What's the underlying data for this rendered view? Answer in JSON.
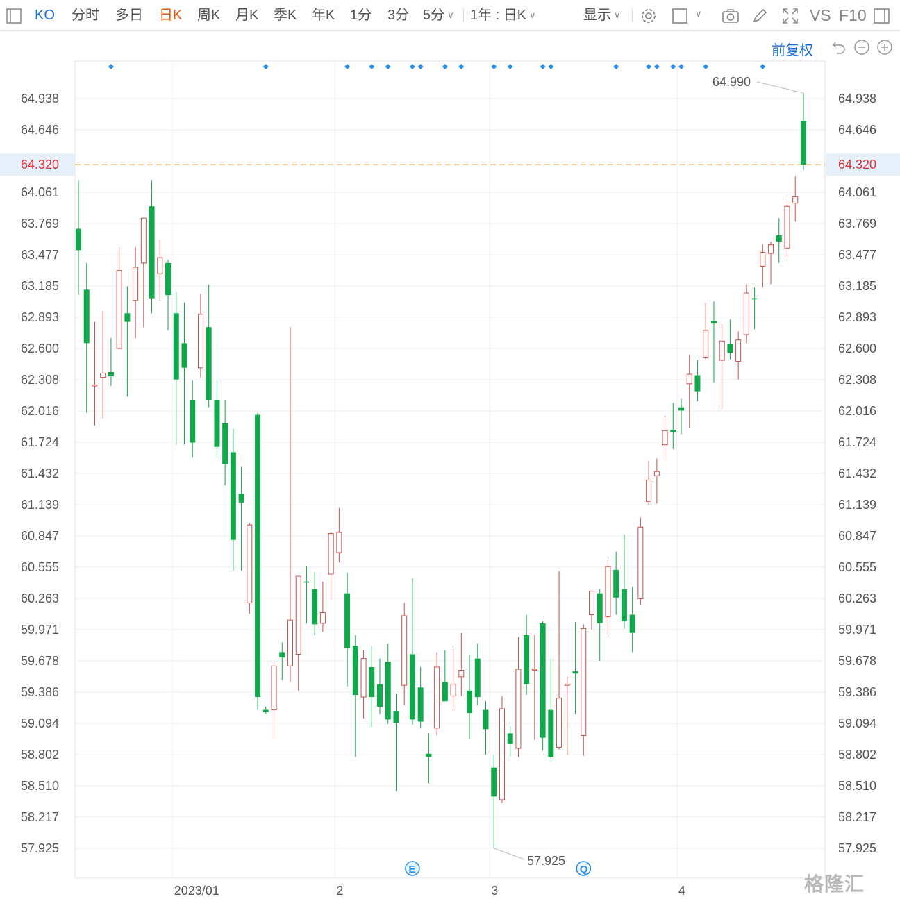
{
  "toolbar": {
    "symbol": "KO",
    "periods": [
      "分时",
      "多日",
      "日K",
      "周K",
      "月K",
      "季K",
      "年K",
      "1分",
      "3分",
      "5分"
    ],
    "active_period": "日K",
    "range_label": "1年 : 日K",
    "display_label": "显示",
    "vs_label": "VS",
    "f10_label": "F10"
  },
  "subbar": {
    "adjust_label": "前复权"
  },
  "icons": [
    "sidebar-toggle-icon",
    "settings-icon",
    "layout-square-icon",
    "camera-icon",
    "pencil-icon",
    "fullscreen-icon",
    "panel-icon",
    "undo-icon",
    "zoom-out-icon",
    "zoom-in-icon"
  ],
  "colors": {
    "up": "#c8504a",
    "down": "#10a84b",
    "marker": "#2d8ee6",
    "last_line": "#e09a30",
    "last_text": "#e03333",
    "active_tab": "#e8590c",
    "link": "#1e6fd0"
  },
  "watermark": "格隆汇",
  "chart_data": {
    "type": "candlestick",
    "title": "",
    "ylabel": "",
    "ylim": [
      57.8,
      65.15
    ],
    "y_ticks": [
      "64.938",
      "64.646",
      "64.320",
      "64.061",
      "63.769",
      "63.477",
      "63.185",
      "62.893",
      "62.600",
      "62.308",
      "62.016",
      "61.724",
      "61.432",
      "61.139",
      "60.847",
      "60.555",
      "60.263",
      "59.971",
      "59.678",
      "59.386",
      "59.094",
      "58.802",
      "58.510",
      "58.217",
      "57.925"
    ],
    "x_ticks": [
      {
        "label": "2023/01",
        "index": 12
      },
      {
        "label": "2",
        "index": 32
      },
      {
        "label": "3",
        "index": 51
      },
      {
        "label": "4",
        "index": 74
      }
    ],
    "last_price": "64.320",
    "high_label": "64.990",
    "low_label": "57.925",
    "grid": true,
    "event_badges": [
      {
        "label": "E",
        "index": 41
      },
      {
        "label": "Q",
        "index": 62
      }
    ],
    "markers": [
      4,
      23,
      33,
      36,
      38,
      41,
      42,
      45,
      47,
      51,
      53,
      57,
      58,
      66,
      70,
      71,
      73,
      74,
      77,
      84
    ],
    "candles": [
      {
        "o": 63.72,
        "h": 64.17,
        "l": 63.1,
        "c": 63.52
      },
      {
        "o": 63.15,
        "h": 63.4,
        "l": 62.0,
        "c": 62.65
      },
      {
        "o": 62.25,
        "h": 62.85,
        "l": 61.88,
        "c": 62.26
      },
      {
        "o": 62.33,
        "h": 62.95,
        "l": 61.95,
        "c": 62.37
      },
      {
        "o": 62.38,
        "h": 62.7,
        "l": 62.25,
        "c": 62.34
      },
      {
        "o": 62.6,
        "h": 63.55,
        "l": 62.6,
        "c": 63.33
      },
      {
        "o": 62.93,
        "h": 63.18,
        "l": 62.15,
        "c": 62.85
      },
      {
        "o": 63.05,
        "h": 63.55,
        "l": 62.7,
        "c": 63.36
      },
      {
        "o": 63.4,
        "h": 63.82,
        "l": 62.8,
        "c": 63.82
      },
      {
        "o": 63.93,
        "h": 64.17,
        "l": 62.93,
        "c": 63.07
      },
      {
        "o": 63.3,
        "h": 63.62,
        "l": 63.05,
        "c": 63.45
      },
      {
        "o": 63.4,
        "h": 63.43,
        "l": 62.77,
        "c": 63.1
      },
      {
        "o": 62.93,
        "h": 63.13,
        "l": 61.7,
        "c": 62.31
      },
      {
        "o": 62.65,
        "h": 63.03,
        "l": 61.7,
        "c": 62.42
      },
      {
        "o": 62.12,
        "h": 62.3,
        "l": 61.58,
        "c": 61.72
      },
      {
        "o": 62.42,
        "h": 63.11,
        "l": 62.33,
        "c": 62.92
      },
      {
        "o": 62.8,
        "h": 63.2,
        "l": 62.05,
        "c": 62.12
      },
      {
        "o": 62.12,
        "h": 62.3,
        "l": 61.58,
        "c": 61.68
      },
      {
        "o": 61.9,
        "h": 62.12,
        "l": 61.32,
        "c": 61.52
      },
      {
        "o": 61.63,
        "h": 61.85,
        "l": 60.52,
        "c": 60.81
      },
      {
        "o": 61.24,
        "h": 61.5,
        "l": 60.52,
        "c": 61.16
      },
      {
        "o": 60.22,
        "h": 60.97,
        "l": 60.12,
        "c": 60.95
      },
      {
        "o": 61.98,
        "h": 62.0,
        "l": 59.22,
        "c": 59.34
      },
      {
        "o": 59.22,
        "h": 59.25,
        "l": 59.18,
        "c": 59.2
      },
      {
        "o": 59.22,
        "h": 59.66,
        "l": 58.95,
        "c": 59.63
      },
      {
        "o": 59.76,
        "h": 59.85,
        "l": 59.5,
        "c": 59.71
      },
      {
        "o": 59.63,
        "h": 62.8,
        "l": 59.48,
        "c": 60.06
      },
      {
        "o": 59.74,
        "h": 60.47,
        "l": 59.4,
        "c": 60.47
      },
      {
        "o": 60.42,
        "h": 60.56,
        "l": 60.03,
        "c": 60.41
      },
      {
        "o": 60.35,
        "h": 60.51,
        "l": 59.92,
        "c": 60.02
      },
      {
        "o": 60.03,
        "h": 60.42,
        "l": 59.95,
        "c": 60.13
      },
      {
        "o": 60.49,
        "h": 60.88,
        "l": 60.25,
        "c": 60.87
      },
      {
        "o": 60.69,
        "h": 61.11,
        "l": 60.6,
        "c": 60.88
      },
      {
        "o": 60.31,
        "h": 60.5,
        "l": 59.44,
        "c": 59.8
      },
      {
        "o": 59.82,
        "h": 59.92,
        "l": 58.78,
        "c": 59.36
      },
      {
        "o": 59.34,
        "h": 59.78,
        "l": 59.14,
        "c": 59.7
      },
      {
        "o": 59.62,
        "h": 59.82,
        "l": 59.06,
        "c": 59.34
      },
      {
        "o": 59.46,
        "h": 59.7,
        "l": 59.18,
        "c": 59.25
      },
      {
        "o": 59.67,
        "h": 59.84,
        "l": 59.09,
        "c": 59.13
      },
      {
        "o": 59.21,
        "h": 59.37,
        "l": 58.46,
        "c": 59.1
      },
      {
        "o": 59.45,
        "h": 60.22,
        "l": 59.26,
        "c": 60.1
      },
      {
        "o": 59.74,
        "h": 60.45,
        "l": 59.08,
        "c": 59.13
      },
      {
        "o": 59.43,
        "h": 59.62,
        "l": 59.05,
        "c": 59.11
      },
      {
        "o": 58.81,
        "h": 59.0,
        "l": 58.53,
        "c": 58.78
      },
      {
        "o": 59.05,
        "h": 59.76,
        "l": 58.98,
        "c": 59.62
      },
      {
        "o": 59.48,
        "h": 59.78,
        "l": 59.31,
        "c": 59.3
      },
      {
        "o": 59.35,
        "h": 59.79,
        "l": 59.22,
        "c": 59.46
      },
      {
        "o": 59.53,
        "h": 59.94,
        "l": 59.35,
        "c": 59.59
      },
      {
        "o": 59.4,
        "h": 59.73,
        "l": 58.95,
        "c": 59.19
      },
      {
        "o": 59.7,
        "h": 59.84,
        "l": 59.26,
        "c": 59.34
      },
      {
        "o": 59.22,
        "h": 59.3,
        "l": 58.8,
        "c": 59.04
      },
      {
        "o": 58.68,
        "h": 58.8,
        "l": 57.925,
        "c": 58.41
      },
      {
        "o": 58.38,
        "h": 59.35,
        "l": 58.35,
        "c": 59.23
      },
      {
        "o": 59.0,
        "h": 59.07,
        "l": 58.78,
        "c": 58.9
      },
      {
        "o": 58.86,
        "h": 59.9,
        "l": 58.78,
        "c": 59.6
      },
      {
        "o": 59.92,
        "h": 60.11,
        "l": 59.36,
        "c": 59.46
      },
      {
        "o": 59.59,
        "h": 59.92,
        "l": 58.94,
        "c": 59.6
      },
      {
        "o": 60.03,
        "h": 60.05,
        "l": 58.84,
        "c": 58.96
      },
      {
        "o": 59.22,
        "h": 59.7,
        "l": 58.74,
        "c": 58.78
      },
      {
        "o": 58.87,
        "h": 60.52,
        "l": 58.85,
        "c": 59.33
      },
      {
        "o": 59.46,
        "h": 59.53,
        "l": 58.8,
        "c": 59.46
      },
      {
        "o": 59.58,
        "h": 60.04,
        "l": 59.18,
        "c": 59.56
      },
      {
        "o": 58.98,
        "h": 60.02,
        "l": 58.79,
        "c": 59.98
      },
      {
        "o": 60.11,
        "h": 60.33,
        "l": 59.97,
        "c": 60.33
      },
      {
        "o": 60.31,
        "h": 60.35,
        "l": 59.68,
        "c": 60.03
      },
      {
        "o": 60.09,
        "h": 60.62,
        "l": 59.93,
        "c": 60.56
      },
      {
        "o": 60.53,
        "h": 60.7,
        "l": 60.11,
        "c": 60.27
      },
      {
        "o": 60.35,
        "h": 60.86,
        "l": 59.98,
        "c": 60.05
      },
      {
        "o": 60.11,
        "h": 60.37,
        "l": 59.76,
        "c": 59.94
      },
      {
        "o": 60.26,
        "h": 61.02,
        "l": 60.2,
        "c": 60.93
      },
      {
        "o": 61.17,
        "h": 61.55,
        "l": 61.14,
        "c": 61.37
      },
      {
        "o": 61.41,
        "h": 61.57,
        "l": 61.15,
        "c": 61.45
      },
      {
        "o": 61.7,
        "h": 61.97,
        "l": 61.55,
        "c": 61.83
      },
      {
        "o": 61.84,
        "h": 62.09,
        "l": 61.66,
        "c": 61.82
      },
      {
        "o": 62.05,
        "h": 62.13,
        "l": 61.8,
        "c": 62.02
      },
      {
        "o": 62.27,
        "h": 62.54,
        "l": 61.86,
        "c": 62.36
      },
      {
        "o": 62.35,
        "h": 62.49,
        "l": 62.11,
        "c": 62.2
      },
      {
        "o": 62.52,
        "h": 63.03,
        "l": 62.49,
        "c": 62.77
      },
      {
        "o": 62.86,
        "h": 63.04,
        "l": 62.28,
        "c": 62.84
      },
      {
        "o": 62.49,
        "h": 62.83,
        "l": 62.03,
        "c": 62.67
      },
      {
        "o": 62.64,
        "h": 62.87,
        "l": 62.5,
        "c": 62.56
      },
      {
        "o": 62.48,
        "h": 62.76,
        "l": 62.31,
        "c": 62.68
      },
      {
        "o": 62.73,
        "h": 63.2,
        "l": 62.65,
        "c": 63.12
      },
      {
        "o": 63.07,
        "h": 63.17,
        "l": 62.78,
        "c": 63.06
      },
      {
        "o": 63.37,
        "h": 63.57,
        "l": 63.17,
        "c": 63.5
      },
      {
        "o": 63.49,
        "h": 63.6,
        "l": 63.2,
        "c": 63.57
      },
      {
        "o": 63.66,
        "h": 63.82,
        "l": 63.4,
        "c": 63.6
      },
      {
        "o": 63.54,
        "h": 64.0,
        "l": 63.43,
        "c": 63.93
      },
      {
        "o": 63.96,
        "h": 64.21,
        "l": 63.79,
        "c": 64.02
      },
      {
        "o": 64.73,
        "h": 64.99,
        "l": 64.27,
        "c": 64.32
      }
    ]
  }
}
